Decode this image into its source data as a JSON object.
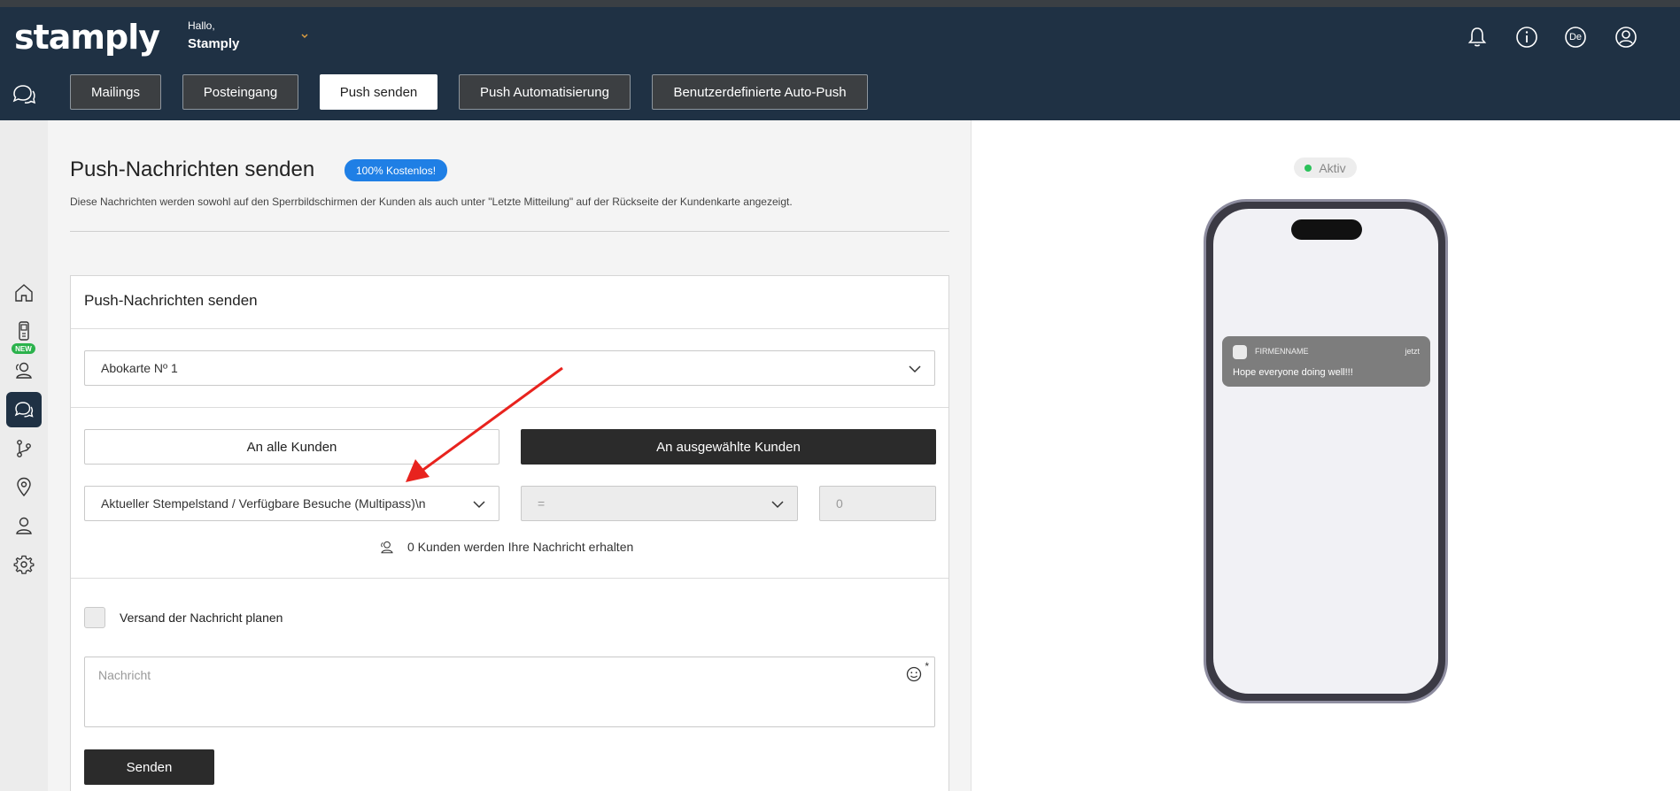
{
  "header": {
    "logo": "stamply",
    "greeting": "Hallo,",
    "user_name": "Stamply",
    "language": "De"
  },
  "tabs": [
    {
      "label": "Mailings",
      "active": false
    },
    {
      "label": "Posteingang",
      "active": false
    },
    {
      "label": "Push senden",
      "active": true
    },
    {
      "label": "Push Automatisierung",
      "active": false
    },
    {
      "label": "Benutzerdefinierte Auto-Push",
      "active": false
    }
  ],
  "sidebar": {
    "new_badge": "NEW",
    "items": [
      "home-icon",
      "device-icon",
      "customers-icon",
      "chat-icon",
      "branch-icon",
      "location-icon",
      "user-icon",
      "gear-icon"
    ],
    "active": "chat-icon"
  },
  "page": {
    "title": "Push-Nachrichten senden",
    "badge": "100% Kostenlos!",
    "subtitle": "Diese Nachrichten werden sowohl auf den Sperrbildschirmen der Kunden als auch unter \"Letzte Mitteilung\" auf der Rückseite der Kundenkarte angezeigt."
  },
  "form": {
    "card_title": "Push-Nachrichten senden",
    "card_select": "Abokarte Nº 1",
    "btn_all": "An alle Kunden",
    "btn_selected": "An ausgewählte Kunden",
    "filter_field": "Aktueller Stempelstand / Verfügbare Besuche (Multipass)\\n",
    "operator": "=",
    "value_placeholder": "0",
    "recipients": "0 Kunden werden Ihre Nachricht erhalten",
    "schedule_label": "Versand der Nachricht planen",
    "message_placeholder": "Nachricht",
    "required_mark": "*",
    "send_button": "Senden"
  },
  "preview": {
    "status": "Aktiv",
    "status_color": "#2bc25a",
    "notif_app": "FIRMENNAME",
    "notif_time": "jetzt",
    "notif_message": "Hope everyone doing well!!!"
  },
  "annotation": {
    "arrow_color": "#e8231e"
  }
}
